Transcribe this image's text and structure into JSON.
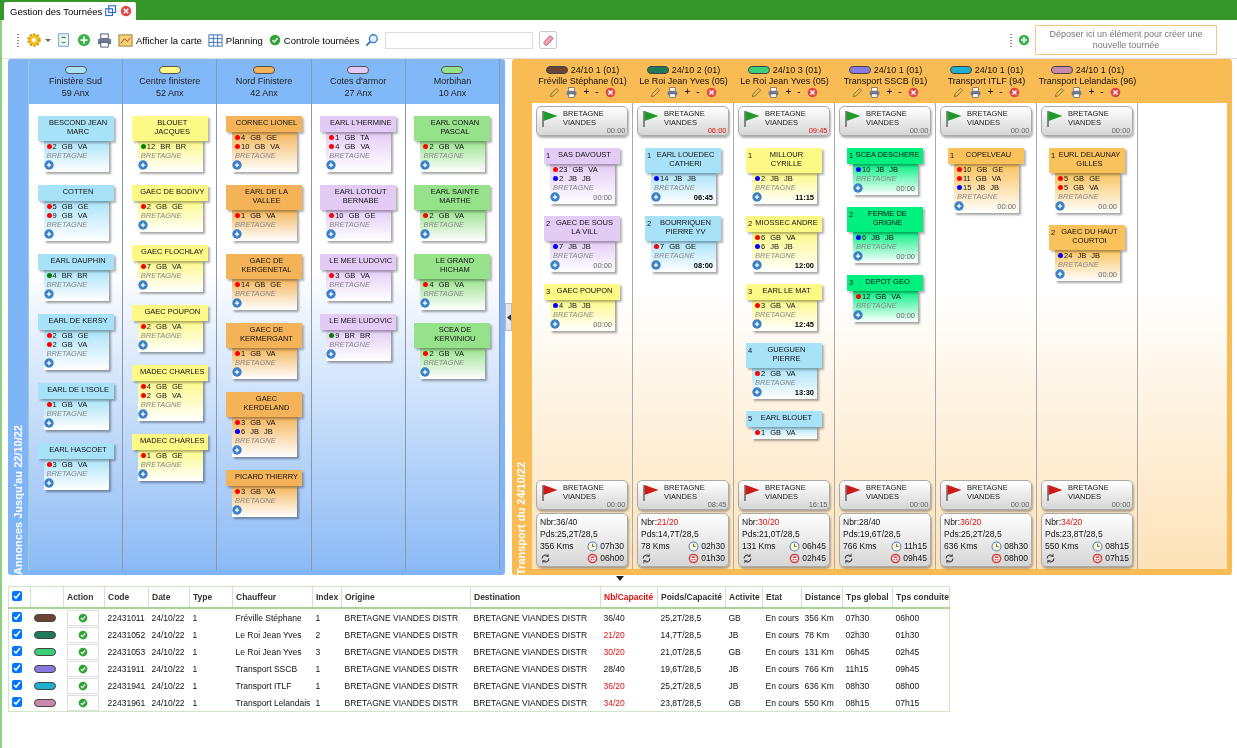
{
  "tab": {
    "title": "Gestion des Tournées"
  },
  "toolbar": {
    "map_button": "Afficher la carte",
    "planning_button": "Planning",
    "control_button": "Controle tournées"
  },
  "drop_zone": {
    "text": "Déposer ici un élément pour créer une nouvelle tournée"
  },
  "annonces": {
    "label": "Annonces Jusqu'au 22/10/22",
    "columns": [
      {
        "name": "Finistère Sud",
        "count": "59 Anx",
        "color": "#a8e2f8",
        "cards": [
          {
            "name": "BESCOND JEAN MARC",
            "items": [
              {
                "color": "#ff0000",
                "text": "2 GB VA"
              }
            ],
            "region": "BRETAGNE"
          },
          {
            "name": "COTTEN",
            "items": [
              {
                "color": "#ff0000",
                "text": "5 GB GE"
              },
              {
                "color": "#ff0000",
                "text": "9 GB VA"
              }
            ],
            "region": "BRETAGNE"
          },
          {
            "name": "EARL DAUPHIN",
            "items": [
              {
                "color": "#008000",
                "text": "4 BR BR"
              }
            ],
            "region": "BRETAGNE"
          },
          {
            "name": "EARL DE KERSY",
            "items": [
              {
                "color": "#ff0000",
                "text": "2 GB GE"
              },
              {
                "color": "#ff0000",
                "text": "2 GB VA"
              }
            ],
            "region": "BRETAGNE"
          },
          {
            "name": "EARL DE L'ISOLE",
            "items": [
              {
                "color": "#ff0000",
                "text": "1 GB VA"
              }
            ],
            "region": "BRETAGNE"
          },
          {
            "name": "EARL HASCOET",
            "items": [
              {
                "color": "#ff0000",
                "text": "3 GB VA"
              }
            ],
            "region": "BRETAGNE"
          }
        ]
      },
      {
        "name": "Centre finistere",
        "count": "52 Anx",
        "color": "#fdf986",
        "cards": [
          {
            "name": "BLOUET JACQUES",
            "items": [
              {
                "color": "#008000",
                "text": "12 BR BR"
              }
            ],
            "region": "BRETAGNE"
          },
          {
            "name": "GAEC DE BODIVY",
            "items": [
              {
                "color": "#ff0000",
                "text": "2 GB GE"
              }
            ],
            "region": "BRETAGNE"
          },
          {
            "name": "GAEC FLOCHLAY",
            "items": [
              {
                "color": "#ff0000",
                "text": "7 GB VA"
              }
            ],
            "region": "BRETAGNE"
          },
          {
            "name": "GAEC POUPON",
            "items": [
              {
                "color": "#ff0000",
                "text": "2 GB VA"
              }
            ],
            "region": "BRETAGNE"
          },
          {
            "name": "MADEC CHARLES",
            "items": [
              {
                "color": "#ff0000",
                "text": "4 GB GE"
              },
              {
                "color": "#ff0000",
                "text": "2 GB VA"
              }
            ],
            "region": "BRETAGNE"
          },
          {
            "name": "MADEC CHARLES",
            "items": [
              {
                "color": "#ff0000",
                "text": "1 GB GE"
              }
            ],
            "region": "BRETAGNE"
          }
        ]
      },
      {
        "name": "Nord Finistere",
        "count": "42 Anx",
        "color": "#f4b358",
        "cards": [
          {
            "name": "CORNEC LIONEL",
            "items": [
              {
                "color": "#ff0000",
                "text": "4 GB GE"
              },
              {
                "color": "#ff0000",
                "text": "10 GB VA"
              }
            ],
            "region": "BRETAGNE"
          },
          {
            "name": "EARL DE LA VALLEE",
            "items": [
              {
                "color": "#ff0000",
                "text": "1 GB VA"
              }
            ],
            "region": "BRETAGNE"
          },
          {
            "name": "GAEC DE KERGENETAL",
            "items": [
              {
                "color": "#ff0000",
                "text": "14 GB GE"
              }
            ],
            "region": "BRETAGNE"
          },
          {
            "name": "GAEC DE KERMERGANT",
            "items": [
              {
                "color": "#ff0000",
                "text": "1 GB VA"
              }
            ],
            "region": "BRETAGNE"
          },
          {
            "name": "GAEC KERDELAND",
            "items": [
              {
                "color": "#ff0000",
                "text": "3 GB VA"
              },
              {
                "color": "#0000ff",
                "text": "6 JB JB"
              }
            ],
            "region": "BRETAGNE"
          },
          {
            "name": "PICARD THIERRY",
            "items": [
              {
                "color": "#ff0000",
                "text": "3 GB VA"
              }
            ],
            "region": "BRETAGNE"
          }
        ]
      },
      {
        "name": "Cotes d'armor",
        "count": "27 Anx",
        "color": "#e3cbf6",
        "cards": [
          {
            "name": "EARL L'HERMINE",
            "items": [
              {
                "color": "#ff0000",
                "text": "1 GB TA"
              },
              {
                "color": "#ff0000",
                "text": "4 GB VA"
              }
            ],
            "region": "BRETAGNE"
          },
          {
            "name": "EARL LOTOUT BERNABE",
            "items": [
              {
                "color": "#ff0000",
                "text": "10 GB GE"
              }
            ],
            "region": "BRETAGNE"
          },
          {
            "name": "LE MEE LUDOVIC",
            "items": [
              {
                "color": "#ff0000",
                "text": "3 GB VA"
              }
            ],
            "region": "BRETAGNE"
          },
          {
            "name": "LE MEE LUDOVIC",
            "items": [
              {
                "color": "#008000",
                "text": "9 BR BR"
              }
            ],
            "region": "BRETAGNE"
          }
        ]
      },
      {
        "name": "Morbihan",
        "count": "10 Anx",
        "color": "#96e28a",
        "cards": [
          {
            "name": "EARL CONAN PASCAL",
            "items": [
              {
                "color": "#ff0000",
                "text": "2 GB VA"
              }
            ],
            "region": "BRETAGNE"
          },
          {
            "name": "EARL SAINTE MARTHE",
            "items": [
              {
                "color": "#ff0000",
                "text": "2 GB VA"
              }
            ],
            "region": "BRETAGNE"
          },
          {
            "name": "LE GRAND HICHAM",
            "items": [
              {
                "color": "#ff0000",
                "text": "4 GB VA"
              }
            ],
            "region": "BRETAGNE"
          },
          {
            "name": "SCEA DE KERVINIOU",
            "items": [
              {
                "color": "#ff0000",
                "text": "2 GB VA"
              }
            ],
            "region": "BRETAGNE"
          }
        ]
      }
    ]
  },
  "transport": {
    "label": "Transport du 24/10/22",
    "tours": [
      {
        "color": "#6b4433",
        "date": "24/10 1 (01)",
        "driver": "Fréville Stéphane (01)",
        "plus": "+",
        "minus": "-",
        "start": {
          "name": "BRETAGNE VIANDES",
          "time": "00:00",
          "late": false
        },
        "cards": [
          {
            "index": "1",
            "name": "SAS DAVOUST",
            "color": "#e3cbf6",
            "items": [
              {
                "color": "#ff0000",
                "text": "23 GB VA"
              },
              {
                "color": "#0000ff",
                "text": "2 JB JB"
              }
            ],
            "region": "BRETAGNE",
            "time": "00:00",
            "planned": false
          },
          {
            "index": "2",
            "name": "GAEC DE SOUS LA VILL",
            "color": "#e3cbf6",
            "items": [
              {
                "color": "#0000ff",
                "text": "7 JB JB"
              }
            ],
            "region": "BRETAGNE",
            "time": "00:00",
            "planned": false
          },
          {
            "index": "3",
            "name": "GAEC POUPON",
            "color": "#fdf986",
            "items": [
              {
                "color": "#0000ff",
                "text": "4 JB JB"
              }
            ],
            "region": "BRETAGNE",
            "time": "00:00",
            "planned": false
          }
        ],
        "end": {
          "name": "BRETAGNE VIANDES",
          "time": "00:00",
          "late": false
        },
        "summary": {
          "nbr_label": "Nbr:",
          "nbr": "36/40",
          "over": false,
          "weight": "Pds:25,2T/28,5",
          "distance": "356 Kms",
          "total_time": "07h30",
          "drive_time": "06h00"
        }
      },
      {
        "color": "#1e7a5a",
        "date": "24/10 2 (01)",
        "driver": "Le Roi Jean Yves (05)",
        "plus": "+",
        "minus": "-",
        "start": {
          "name": "BRETAGNE VIANDES",
          "time": "06:00",
          "late": true
        },
        "cards": [
          {
            "index": "1",
            "name": "EARL LOUEDEC CATHERI",
            "color": "#a8e2f8",
            "items": [
              {
                "color": "#0000ff",
                "text": "14 JB JB"
              }
            ],
            "region": "BRETAGNE",
            "time": "06:45",
            "planned": true
          },
          {
            "index": "2",
            "name": "BOURRIQUEN PIERRE YV",
            "color": "#a8e2f8",
            "items": [
              {
                "color": "#ff0000",
                "text": "7 GB GE"
              }
            ],
            "region": "BRETAGNE",
            "time": "08:00",
            "planned": true
          }
        ],
        "end": {
          "name": "BRETAGNE VIANDES",
          "time": "08:45",
          "late": false
        },
        "summary": {
          "nbr_label": "Nbr:",
          "nbr": "21/20",
          "over": true,
          "weight": "Pds:14,7T/28,5",
          "distance": "78 Kms",
          "total_time": "02h30",
          "drive_time": "01h30"
        }
      },
      {
        "color": "#3ccf78",
        "date": "24/10 3 (01)",
        "driver": "Le Roi Jean Yves (05)",
        "plus": "+",
        "minus": "-",
        "start": {
          "name": "BRETAGNE VIANDES",
          "time": "09:45",
          "late": true
        },
        "cards": [
          {
            "index": "1",
            "name": "MILLOUR CYRILLE",
            "color": "#fdf986",
            "items": [
              {
                "color": "#0000ff",
                "text": "2 JB JB"
              }
            ],
            "region": "BRETAGNE",
            "time": "11:15",
            "planned": true
          },
          {
            "index": "2",
            "name": "MIOSSEC ANDRE",
            "color": "#fdf986",
            "items": [
              {
                "color": "#ff0000",
                "text": "6 GB VA"
              },
              {
                "color": "#0000ff",
                "text": "6 JB JB"
              }
            ],
            "region": "BRETAGNE",
            "time": "12:00",
            "planned": true
          },
          {
            "index": "3",
            "name": "EARL LE MAT",
            "color": "#fdf986",
            "items": [
              {
                "color": "#ff0000",
                "text": "3 GB VA"
              }
            ],
            "region": "BRETAGNE",
            "time": "12:45",
            "planned": true
          },
          {
            "index": "4",
            "name": "GUEGUEN PIERRE",
            "color": "#a8e2f8",
            "items": [
              {
                "color": "#ff0000",
                "text": "2 GB VA"
              }
            ],
            "region": "BRETAGNE",
            "time": "13:30",
            "planned": true
          },
          {
            "index": "5",
            "name": "EARL BLOUET",
            "color": "#a8e2f8",
            "items": [
              {
                "color": "#ff0000",
                "text": "1 GB VA"
              }
            ]
          }
        ],
        "end": {
          "name": "BRETAGNE VIANDES",
          "time": "16:15",
          "late": false
        },
        "summary": {
          "nbr_label": "Nbr:",
          "nbr": "30/20",
          "over": true,
          "weight": "Pds:21,0T/28,5",
          "distance": "131 Kms",
          "total_time": "06h45",
          "drive_time": "02h45"
        }
      },
      {
        "color": "#8878e0",
        "date": "24/10 1 (01)",
        "driver": "Transport SSCB (91)",
        "plus": "+",
        "minus": "-",
        "start": {
          "name": "BRETAGNE VIANDES",
          "time": "00:00",
          "late": false
        },
        "cards": [
          {
            "index": "1",
            "name": "SCEA DESCHERE",
            "color": "#00f080",
            "items": [
              {
                "color": "#0000ff",
                "text": "10 JB JB"
              }
            ],
            "region": "BRETAGNE",
            "time": "00:00",
            "planned": false
          },
          {
            "index": "2",
            "name": "FERME DE GRIGNE",
            "color": "#00f080",
            "items": [
              {
                "color": "#0000ff",
                "text": "6 JB JB"
              }
            ],
            "region": "BRETAGNE",
            "time": "00:00",
            "planned": false
          },
          {
            "index": "3",
            "name": "DEPOT GEO",
            "color": "#00f080",
            "items": [
              {
                "color": "#ff0000",
                "text": "12 GB VA"
              }
            ],
            "region": "BRETAGNE",
            "time": "00:00",
            "planned": false
          }
        ],
        "end": {
          "name": "BRETAGNE VIANDES",
          "time": "00:00",
          "late": false
        },
        "summary": {
          "nbr_label": "Nbr:",
          "nbr": "28/40",
          "over": false,
          "weight": "Pds:19,6T/28,5",
          "distance": "766 Kms",
          "total_time": "11h15",
          "drive_time": "09h45"
        }
      },
      {
        "color": "#1fb0d0",
        "date": "24/10 1 (01)",
        "driver": "Transport ITLF (94)",
        "plus": "+",
        "minus": "-",
        "start": {
          "name": "BRETAGNE VIANDES",
          "time": "00:00",
          "late": false
        },
        "cards": [
          {
            "index": "1",
            "name": "COPELVEAU",
            "color": "#f9c25a",
            "items": [
              {
                "color": "#ff0000",
                "text": "10 GB GE"
              },
              {
                "color": "#ff0000",
                "text": "11 GB VA"
              },
              {
                "color": "#0000ff",
                "text": "15 JB JB"
              }
            ],
            "region": "BRETAGNE",
            "time": "00:00",
            "planned": false
          }
        ],
        "end": {
          "name": "BRETAGNE VIANDES",
          "time": "00:00",
          "late": false
        },
        "summary": {
          "nbr_label": "Nbr:",
          "nbr": "36/20",
          "over": true,
          "weight": "Pds:25,2T/28,5",
          "distance": "636 Kms",
          "total_time": "08h30",
          "drive_time": "08h00"
        }
      },
      {
        "color": "#c88aaa",
        "date": "24/10 1 (01)",
        "driver": "Transport Lelandais (96)",
        "plus": "+",
        "minus": "-",
        "start": {
          "name": "BRETAGNE VIANDES",
          "time": "00:00",
          "late": false
        },
        "cards": [
          {
            "index": "1",
            "name": "EURL DELAUNAY GILLES",
            "color": "#f9c25a",
            "items": [
              {
                "color": "#ff0000",
                "text": "5 GB GE"
              },
              {
                "color": "#ff0000",
                "text": "5 GB VA"
              }
            ],
            "region": "BRETAGNE",
            "time": "00:00",
            "planned": false
          },
          {
            "index": "2",
            "name": "GAEC DU HAUT COURTOI",
            "color": "#f9c25a",
            "items": [
              {
                "color": "#0000ff",
                "text": "24 JB JB"
              }
            ],
            "region": "BRETAGNE",
            "time": "00:00",
            "planned": false
          }
        ],
        "end": {
          "name": "BRETAGNE VIANDES",
          "time": "00:00",
          "late": false
        },
        "summary": {
          "nbr_label": "Nbr:",
          "nbr": "34/20",
          "over": true,
          "weight": "Pds:23,8T/28,5",
          "distance": "550 Kms",
          "total_time": "08h15",
          "drive_time": "07h15"
        }
      }
    ]
  },
  "table": {
    "all_checked": true,
    "columns": [
      {
        "label": "Action",
        "alert": false
      },
      {
        "label": "Code",
        "alert": false
      },
      {
        "label": "Date",
        "alert": false
      },
      {
        "label": "Type",
        "alert": false
      },
      {
        "label": "Chauffeur",
        "alert": false
      },
      {
        "label": "Index",
        "alert": false
      },
      {
        "label": "Origine",
        "alert": false
      },
      {
        "label": "Destination",
        "alert": false
      },
      {
        "label": "Nb/Capacité",
        "alert": true
      },
      {
        "label": "Poids/Capacité",
        "alert": false
      },
      {
        "label": "Activite",
        "alert": false
      },
      {
        "label": "Etat",
        "alert": false
      },
      {
        "label": "Distance",
        "alert": false
      },
      {
        "label": "Tps global",
        "alert": false
      },
      {
        "label": "Tps conduite",
        "alert": false
      }
    ],
    "rows": [
      {
        "checked": true,
        "color": "#6b4433",
        "code": "22431011",
        "date": "24/10/22",
        "type": "1",
        "driver": "Fréville Stéphane",
        "index": "1",
        "origin": "BRETAGNE VIANDES DISTR",
        "destination": "BRETAGNE VIANDES DISTR",
        "nb": "36/40",
        "over": false,
        "weight": "25,2T/28,5",
        "activity": "GB",
        "state": "En cours",
        "distance": "356 Km",
        "total_time": "07h30",
        "drive_time": "06h00"
      },
      {
        "checked": true,
        "color": "#1e7a5a",
        "code": "22431052",
        "date": "24/10/22",
        "type": "1",
        "driver": "Le Roi Jean Yves",
        "index": "2",
        "origin": "BRETAGNE VIANDES DISTR",
        "destination": "BRETAGNE VIANDES DISTR",
        "nb": "21/20",
        "over": true,
        "weight": "14,7T/28,5",
        "activity": "JB",
        "state": "En cours",
        "distance": "78 Km",
        "total_time": "02h30",
        "drive_time": "01h30"
      },
      {
        "checked": true,
        "color": "#3ccf78",
        "code": "22431053",
        "date": "24/10/22",
        "type": "1",
        "driver": "Le Roi Jean Yves",
        "index": "3",
        "origin": "BRETAGNE VIANDES DISTR",
        "destination": "BRETAGNE VIANDES DISTR",
        "nb": "30/20",
        "over": true,
        "weight": "21,0T/28,5",
        "activity": "GB",
        "state": "En cours",
        "distance": "131 Km",
        "total_time": "06h45",
        "drive_time": "02h45"
      },
      {
        "checked": true,
        "color": "#8878e0",
        "code": "22431911",
        "date": "24/10/22",
        "type": "1",
        "driver": "Transport SSCB",
        "index": "1",
        "origin": "BRETAGNE VIANDES DISTR",
        "destination": "BRETAGNE VIANDES DISTR",
        "nb": "28/40",
        "over": false,
        "weight": "19,6T/28,5",
        "activity": "JB",
        "state": "En cours",
        "distance": "766 Km",
        "total_time": "11h15",
        "drive_time": "09h45"
      },
      {
        "checked": true,
        "color": "#1fb0d0",
        "code": "22431941",
        "date": "24/10/22",
        "type": "1",
        "driver": "Transport ITLF",
        "index": "1",
        "origin": "BRETAGNE VIANDES DISTR",
        "destination": "BRETAGNE VIANDES DISTR",
        "nb": "36/20",
        "over": true,
        "weight": "25,2T/28,5",
        "activity": "JB",
        "state": "En cours",
        "distance": "636 Km",
        "total_time": "08h30",
        "drive_time": "08h00"
      },
      {
        "checked": true,
        "color": "#c88aaa",
        "code": "22431961",
        "date": "24/10/22",
        "type": "1",
        "driver": "Transport Lelandais",
        "index": "1",
        "origin": "BRETAGNE VIANDES DISTR",
        "destination": "BRETAGNE VIANDES DISTR",
        "nb": "34/20",
        "over": true,
        "weight": "23,8T/28,5",
        "activity": "GB",
        "state": "En cours",
        "distance": "550 Km",
        "total_time": "08h15",
        "drive_time": "07h15"
      }
    ]
  }
}
